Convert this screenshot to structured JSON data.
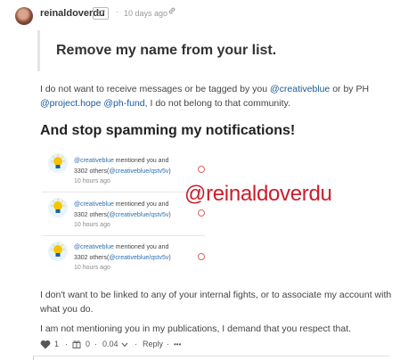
{
  "post": {
    "author": "reinaldoverdu",
    "reputation": "67",
    "separator": "·",
    "time_ago": "10 days ago",
    "quote": "Remove my name from your list.",
    "para1": {
      "text1": "I do not want to receive messages or be tagged by you ",
      "mention1": "@creativeblue",
      "text2": " or by PH",
      "mention2": "@project.hope",
      "space": " ",
      "mention3": "@ph-fund",
      "text3": ", I do not belong to that community."
    },
    "heading": "And stop spamming my notifications!",
    "notifications": [
      {
        "user": "@creativeblue",
        "line1_rest": " mentioned you and",
        "line2_pre": "3302 others(",
        "line2_link": "@creativeblue/qstv5v",
        "line2_post": ")",
        "time": "10 hours ago"
      },
      {
        "user": "@creativeblue",
        "line1_rest": " mentioned you and",
        "line2_pre": "3302 others(",
        "line2_link": "@creativeblue/qstv5v",
        "line2_post": ")",
        "time": "10 hours ago"
      },
      {
        "user": "@creativeblue",
        "line1_rest": " mentioned you and",
        "line2_pre": "3302 others(",
        "line2_link": "@creativeblue/qstv5v",
        "line2_post": ")",
        "time": "10 hours ago"
      }
    ],
    "watermark": "@reinaldoverdu",
    "para2": "I don't want to be linked to any of your internal fights, or to associate my account with what you do.",
    "para3": "I am not mentioning you in my publications, I demand that you respect that."
  },
  "footer": {
    "votes": "1",
    "gift_count": "0",
    "payout": "0.04",
    "reply_label": "Reply",
    "more_label": "•••",
    "sep": "·"
  },
  "colors": {
    "mention": "#1a5a99",
    "watermark": "#cc1c2a",
    "unread_dot": "#e0625e",
    "bulb": "#f7c400",
    "bulb_background": "#e6f4fb"
  },
  "icons": [
    "avatar",
    "link-icon",
    "lightbulb-icon",
    "unread-dot",
    "heart-icon",
    "chevron-down-icon",
    "gift-icon"
  ]
}
